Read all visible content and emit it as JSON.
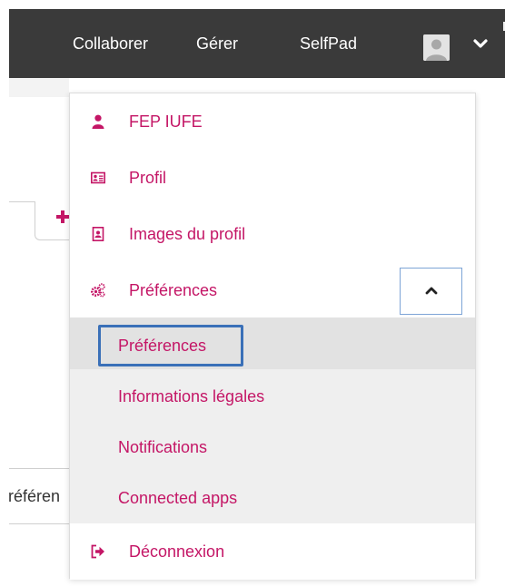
{
  "nav": {
    "items": [
      "Collaborer",
      "Gérer",
      "SelfPad"
    ]
  },
  "background": {
    "partial_text": "référen"
  },
  "menu": {
    "user_name": "FEP IUFE",
    "profile": "Profil",
    "profile_images": "Images du profil",
    "preferences": "Préférences",
    "submenu": [
      "Préférences",
      "Informations légales",
      "Notifications",
      "Connected apps"
    ],
    "logout": "Déconnexion"
  },
  "icons": {
    "user": "user-icon",
    "profile": "id-card-icon",
    "profile_images": "portrait-icon",
    "preferences": "gears-icon",
    "logout": "sign-out-icon"
  },
  "colors": {
    "accent": "#c41666",
    "topbar": "#3a3a3a",
    "focus": "#3a70b8"
  }
}
